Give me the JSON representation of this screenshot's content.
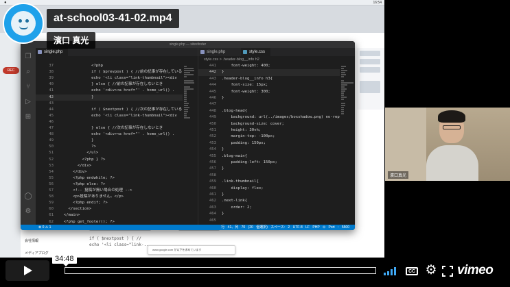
{
  "player": {
    "title": "at-school03-41-02.mp4",
    "byline": "濱口 真光",
    "timecode": "34:48",
    "progress_fraction": 0.0,
    "brand": "vimeo"
  },
  "webcam": {
    "name_tag": "濱口真光"
  },
  "desktop": {
    "menubar_clock": "16:54",
    "popup_text": "www.google.com が以下を求めています",
    "bottom_code": [
      "if ( $nextpost ) { //",
      "echo '<li class=\"link-..."
    ],
    "label_hints": [
      "会社情報",
      "メディアプログ"
    ],
    "red_pill": "REC"
  },
  "vscode": {
    "window_title": "single.php — sitesfinder",
    "left_tab": "single.php",
    "right_tabs": [
      "single.php",
      "style.css"
    ],
    "right_breadcrumb": "style.css > .header-blog__info h2",
    "left_code": [
      {
        "n": "37",
        "t": "              <?php"
      },
      {
        "n": "38",
        "t": "              if ( $prevpost ) { //前の記事が存在しているとき"
      },
      {
        "n": "39",
        "t": "              echo '<li class=\"link-thumbnail\"><div"
      },
      {
        "n": "40",
        "t": "              } else { //前の記事が存在しないとき"
      },
      {
        "n": "41",
        "t": "              echo '<div><a href=\"' . home_url() ."
      },
      {
        "n": "42",
        "t": "              }"
      },
      {
        "n": "43",
        "t": ""
      },
      {
        "n": "44",
        "t": "              if ( $nextpost ) { //次の記事が存在しているとき"
      },
      {
        "n": "45",
        "t": "              echo '<li class=\"link-thumbnail\"><div"
      },
      {
        "n": "46",
        "t": ""
      },
      {
        "n": "47",
        "t": "              } else { //次の記事が存在しないとき"
      },
      {
        "n": "48",
        "t": "              echo '<div><a href=\"' . home_url() ."
      },
      {
        "n": "49",
        "t": "              }"
      },
      {
        "n": "50",
        "t": "              ?>"
      },
      {
        "n": "51",
        "t": "            </ul>"
      },
      {
        "n": "52",
        "t": "          <?php } ?>"
      },
      {
        "n": "53",
        "t": "        </div>"
      },
      {
        "n": "54",
        "t": "      </div>"
      },
      {
        "n": "55",
        "t": "      <?php endwhile; ?>"
      },
      {
        "n": "56",
        "t": "      <?php else: ?>"
      },
      {
        "n": "57",
        "t": "      <!-- 投稿が無い場合の処理 -->"
      },
      {
        "n": "58",
        "t": "      <p>投稿がありません。</p>"
      },
      {
        "n": "59",
        "t": "      <?php endif; ?>"
      },
      {
        "n": "60",
        "t": "    </section>"
      },
      {
        "n": "61",
        "t": "  </main>"
      },
      {
        "n": "62",
        "t": "  <?php get_footer(); ?>"
      }
    ],
    "right_code": [
      {
        "n": "441",
        "t": "    font-weight: 400;"
      },
      {
        "n": "442",
        "t": "}"
      },
      {
        "n": "443",
        "t": ".header-blog__info h3{"
      },
      {
        "n": "444",
        "t": "    font-size: 15px;"
      },
      {
        "n": "445",
        "t": "    font-weight: 300;"
      },
      {
        "n": "446",
        "t": "}"
      },
      {
        "n": "447",
        "t": ""
      },
      {
        "n": "448",
        "t": ".blog-head{"
      },
      {
        "n": "449",
        "t": "    background: url(../images/boxshadow.png) no-repeat"
      },
      {
        "n": "450",
        "t": "    background-size: cover;"
      },
      {
        "n": "451",
        "t": "    height: 30vh;"
      },
      {
        "n": "452",
        "t": "    margin-top: -100px;"
      },
      {
        "n": "453",
        "t": "    padding: 150px;"
      },
      {
        "n": "454",
        "t": "}"
      },
      {
        "n": "455",
        "t": ".blog-main{"
      },
      {
        "n": "456",
        "t": "    padding-left: 150px;"
      },
      {
        "n": "457",
        "t": "}"
      },
      {
        "n": "458",
        "t": ""
      },
      {
        "n": "459",
        "t": ".link-thumbnail{"
      },
      {
        "n": "460",
        "t": "    display: flex;"
      },
      {
        "n": "461",
        "t": "}"
      },
      {
        "n": "462",
        "t": ".next-link{"
      },
      {
        "n": "463",
        "t": "    order: 2;"
      },
      {
        "n": "464",
        "t": "}"
      },
      {
        "n": "465",
        "t": ""
      }
    ],
    "current_line_right": "442",
    "current_line_left": "42",
    "status_left": "⊗ 0 ⚠ 1",
    "status_right": "行 41、列 70 (20 個選択)  スペース: 2  UTF-8  LF  PHP  ⊙ Port : 5500"
  },
  "colors": {
    "vscode_status": "#007acc",
    "volume_active": "#3fa8f4",
    "logo_blue": "#1ea1ea"
  }
}
